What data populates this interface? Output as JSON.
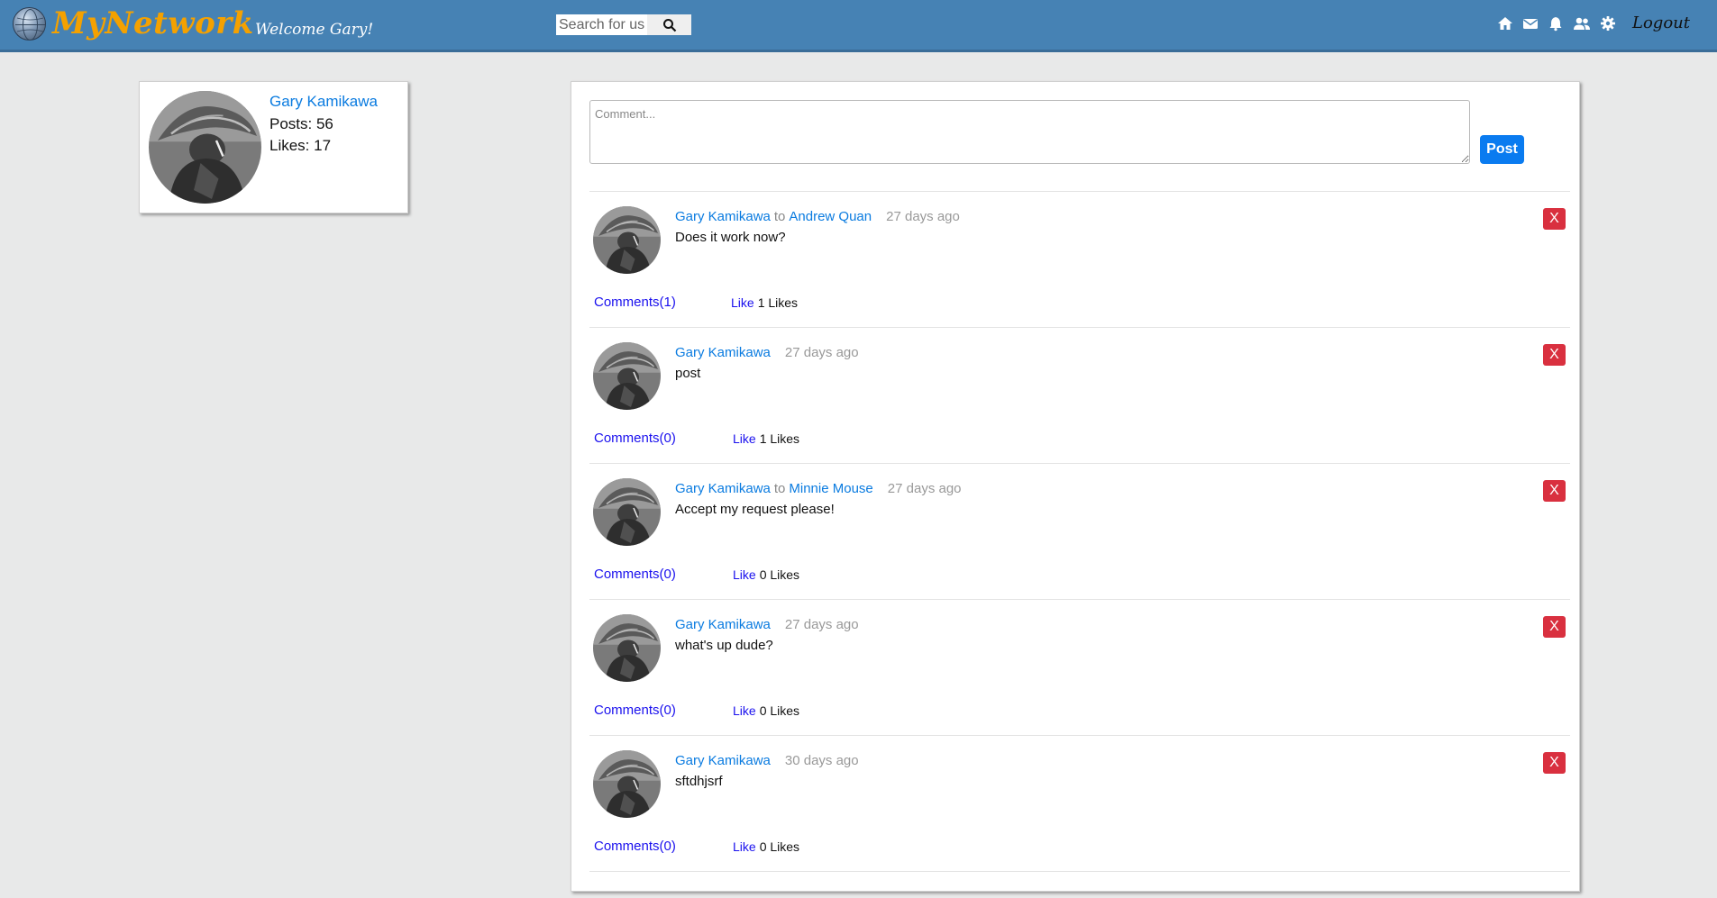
{
  "header": {
    "logo_text": "MyNetwork",
    "welcome": "Welcome Gary!",
    "search": {
      "placeholder": "Search for users"
    },
    "nav_icons": [
      "home-icon",
      "envelope-icon",
      "bell-icon",
      "users-icon",
      "gear-icon"
    ],
    "logout_label": "Logout"
  },
  "profile": {
    "name": "Gary Kamikawa",
    "posts": "Posts: 56",
    "likes": "Likes: 17"
  },
  "composer": {
    "placeholder": "Comment...",
    "post_label": "Post"
  },
  "posts": [
    {
      "author": "Gary Kamikawa",
      "to_word": "to",
      "recipient": "Andrew Quan",
      "time": "27 days ago",
      "body": "Does it work now?",
      "comments": "Comments(1)",
      "like_label": "Like",
      "likes": "1 Likes",
      "delete_label": "X"
    },
    {
      "author": "Gary Kamikawa",
      "to_word": "",
      "recipient": "",
      "time": "27 days ago",
      "body": "post",
      "comments": "Comments(0)",
      "like_label": "Like",
      "likes": "1 Likes",
      "delete_label": "X"
    },
    {
      "author": "Gary Kamikawa",
      "to_word": "to",
      "recipient": "Minnie Mouse",
      "time": "27 days ago",
      "body": "Accept my request please!",
      "comments": "Comments(0)",
      "like_label": "Like",
      "likes": "0 Likes",
      "delete_label": "X"
    },
    {
      "author": "Gary Kamikawa",
      "to_word": "",
      "recipient": "",
      "time": "27 days ago",
      "body": "what's up dude?",
      "comments": "Comments(0)",
      "like_label": "Like",
      "likes": "0 Likes",
      "delete_label": "X"
    },
    {
      "author": "Gary Kamikawa",
      "to_word": "",
      "recipient": "",
      "time": "30 days ago",
      "body": "sftdhjsrf",
      "comments": "Comments(0)",
      "like_label": "Like",
      "likes": "0 Likes",
      "delete_label": "X"
    }
  ],
  "colors": {
    "topbar": "#4682b4",
    "logo": "#f4a100",
    "link": "#0a7be0",
    "delete": "#d9303f",
    "post_button": "#0a7bf0"
  }
}
